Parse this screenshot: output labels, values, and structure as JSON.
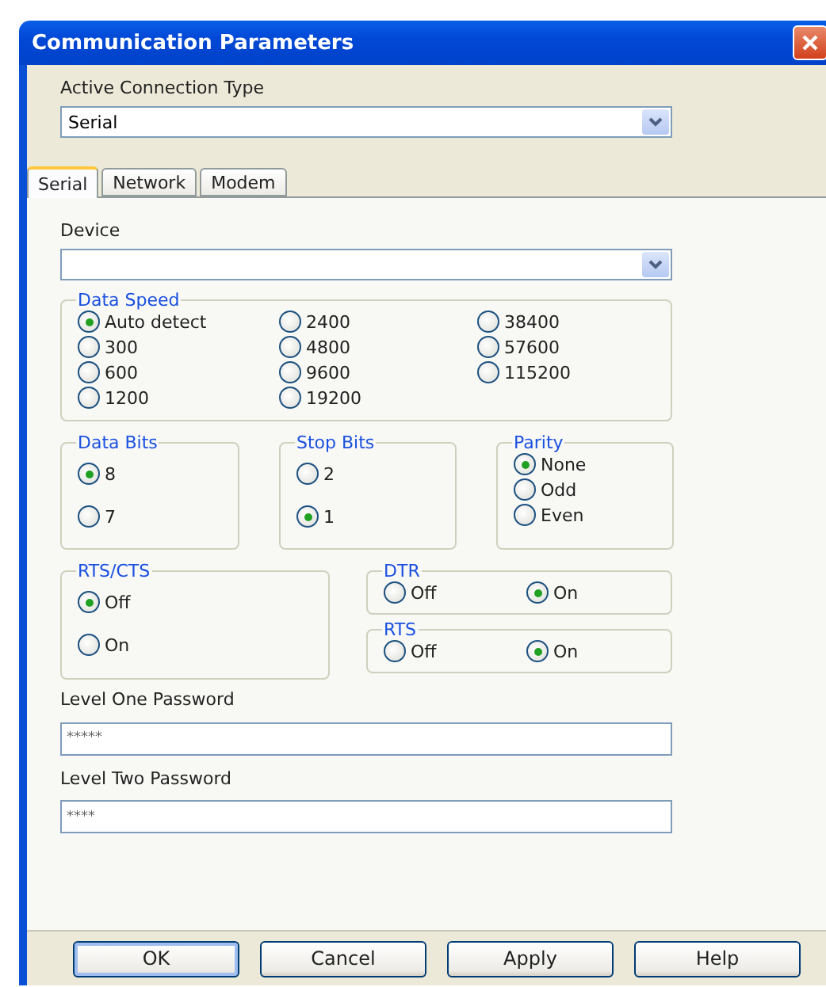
{
  "window": {
    "title": "Communication Parameters"
  },
  "connection_type": {
    "label": "Active Connection Type",
    "value": "Serial"
  },
  "tabs": [
    {
      "label": "Serial",
      "selected": true
    },
    {
      "label": "Network",
      "selected": false
    },
    {
      "label": "Modem",
      "selected": false
    }
  ],
  "device": {
    "label": "Device"
  },
  "speed_group": {
    "title": "Data Speed",
    "kind": "grid",
    "options": [
      {
        "label": "Auto detect",
        "selected": true
      },
      {
        "label": "2400",
        "selected": false
      },
      {
        "label": "38400",
        "selected": false
      },
      {
        "label": "300",
        "selected": false
      },
      {
        "label": "4800",
        "selected": false
      },
      {
        "label": "57600",
        "selected": false
      },
      {
        "label": "600",
        "selected": false
      },
      {
        "label": "9600",
        "selected": false
      },
      {
        "label": "115200",
        "selected": false
      },
      {
        "label": "1200",
        "selected": false
      },
      {
        "label": "19200",
        "selected": false
      }
    ]
  },
  "format_groups": [
    {
      "title": "Data Bits",
      "kind": "column",
      "options": [
        {
          "label": "8",
          "selected": true
        },
        {
          "label": "7",
          "selected": false
        }
      ]
    },
    {
      "title": "Stop Bits",
      "kind": "column",
      "options": [
        {
          "label": "2",
          "selected": false
        },
        {
          "label": "1",
          "selected": true
        }
      ]
    },
    {
      "title": "Parity",
      "kind": "list",
      "options": [
        {
          "label": "None",
          "selected": true
        },
        {
          "label": "Odd",
          "selected": false
        },
        {
          "label": "Even",
          "selected": false
        }
      ]
    }
  ],
  "flow_group": {
    "title": "RTS/CTS",
    "kind": "column",
    "options": [
      {
        "label": "Off",
        "selected": true
      },
      {
        "label": "On",
        "selected": false
      }
    ]
  },
  "line_groups": [
    {
      "title": "DTR",
      "kind": "row",
      "options": [
        {
          "label": "Off",
          "selected": false
        },
        {
          "label": "On",
          "selected": true
        }
      ]
    },
    {
      "title": "RTS",
      "kind": "row",
      "options": [
        {
          "label": "Off",
          "selected": false
        },
        {
          "label": "On",
          "selected": true
        }
      ]
    }
  ],
  "passwords": [
    {
      "label": "Level One Password",
      "value": "*****"
    },
    {
      "label": "Level Two Password",
      "value": "****"
    }
  ],
  "buttons": [
    {
      "label": "OK",
      "default": true
    },
    {
      "label": "Cancel",
      "default": false
    },
    {
      "label": "Apply",
      "default": false
    },
    {
      "label": "Help",
      "default": false
    }
  ]
}
